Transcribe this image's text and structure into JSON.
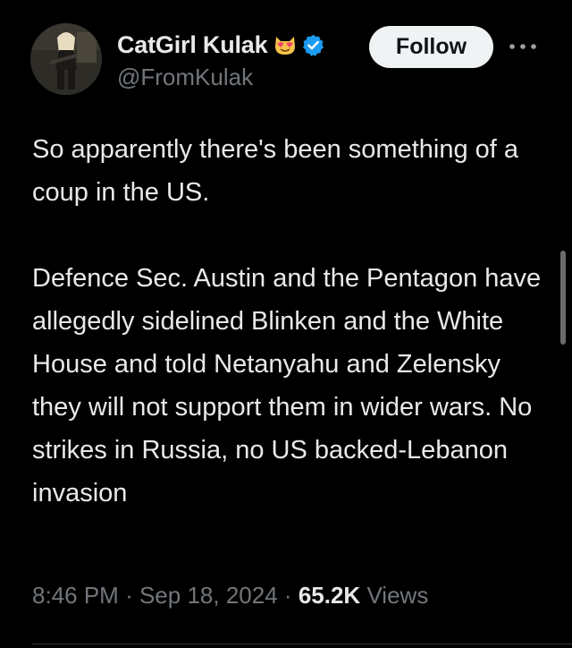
{
  "author": {
    "display_name": "CatGirl Kulak",
    "handle": "@FromKulak",
    "emoji": "cat-heart-eyes-icon",
    "verified_icon": "verified-badge-icon",
    "verified_color": "#1d9bf0"
  },
  "actions": {
    "follow_label": "Follow",
    "more_icon": "more-dots-icon"
  },
  "tweet": {
    "paragraphs": [
      "So apparently there's been something of a coup in the US.",
      "Defence Sec. Austin and the Pentagon have allegedly sidelined Blinken and the White House and told Netanyahu and Zelensky they will not support them in wider wars. No strikes in Russia, no US backed-Lebanon invasion"
    ]
  },
  "meta": {
    "time": "8:46 PM",
    "separator": "·",
    "date": "Sep 18, 2024",
    "views_count": "65.2K",
    "views_label": "Views"
  },
  "colors": {
    "background": "#000000",
    "text": "#e7e9ea",
    "secondary": "#71767b",
    "follow_bg": "#eff3f4"
  }
}
